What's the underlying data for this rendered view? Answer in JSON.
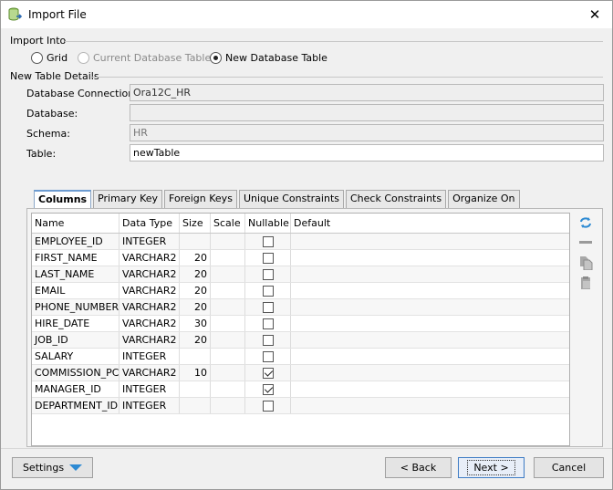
{
  "window": {
    "title": "Import File",
    "close_glyph": "✕"
  },
  "import_into": {
    "label": "Import Into",
    "options": [
      {
        "label": "Grid",
        "checked": false,
        "disabled": false
      },
      {
        "label": "Current Database Table",
        "checked": false,
        "disabled": true
      },
      {
        "label": "New Database Table",
        "checked": true,
        "disabled": false
      }
    ]
  },
  "details": {
    "label": "New Table Details",
    "connection_label": "Database Connection:",
    "connection_value": "Ora12C_HR",
    "database_label": "Database:",
    "database_value": "",
    "schema_label": "Schema:",
    "schema_value": "HR",
    "table_label": "Table:",
    "table_value": "newTable"
  },
  "tabs": [
    "Columns",
    "Primary Key",
    "Foreign Keys",
    "Unique Constraints",
    "Check Constraints",
    "Organize On"
  ],
  "columns": {
    "headers": [
      "Name",
      "Data Type",
      "Size",
      "Scale",
      "Nullable",
      "Default"
    ],
    "rows": [
      {
        "name": "EMPLOYEE_ID",
        "type": "INTEGER",
        "size": "",
        "scale": "",
        "nullable": false,
        "default": ""
      },
      {
        "name": "FIRST_NAME",
        "type": "VARCHAR2",
        "size": "20",
        "scale": "",
        "nullable": false,
        "default": ""
      },
      {
        "name": "LAST_NAME",
        "type": "VARCHAR2",
        "size": "20",
        "scale": "",
        "nullable": false,
        "default": ""
      },
      {
        "name": "EMAIL",
        "type": "VARCHAR2",
        "size": "20",
        "scale": "",
        "nullable": false,
        "default": ""
      },
      {
        "name": "PHONE_NUMBER",
        "type": "VARCHAR2",
        "size": "20",
        "scale": "",
        "nullable": false,
        "default": ""
      },
      {
        "name": "HIRE_DATE",
        "type": "VARCHAR2",
        "size": "30",
        "scale": "",
        "nullable": false,
        "default": ""
      },
      {
        "name": "JOB_ID",
        "type": "VARCHAR2",
        "size": "20",
        "scale": "",
        "nullable": false,
        "default": ""
      },
      {
        "name": "SALARY",
        "type": "INTEGER",
        "size": "",
        "scale": "",
        "nullable": false,
        "default": ""
      },
      {
        "name": "COMMISSION_PCT",
        "type": "VARCHAR2",
        "size": "10",
        "scale": "",
        "nullable": true,
        "default": ""
      },
      {
        "name": "MANAGER_ID",
        "type": "INTEGER",
        "size": "",
        "scale": "",
        "nullable": true,
        "default": ""
      },
      {
        "name": "DEPARTMENT_ID",
        "type": "INTEGER",
        "size": "",
        "scale": "",
        "nullable": false,
        "default": ""
      }
    ]
  },
  "side_icons": [
    "refresh-icon",
    "remove-icon",
    "copy-icon",
    "paste-icon"
  ],
  "footer": {
    "settings_label": "Settings",
    "back_label": "< Back",
    "next_label": "Next >",
    "cancel_label": "Cancel"
  },
  "colors": {
    "accent": "#2d8ad3",
    "focus_border": "#3d7bc4"
  }
}
